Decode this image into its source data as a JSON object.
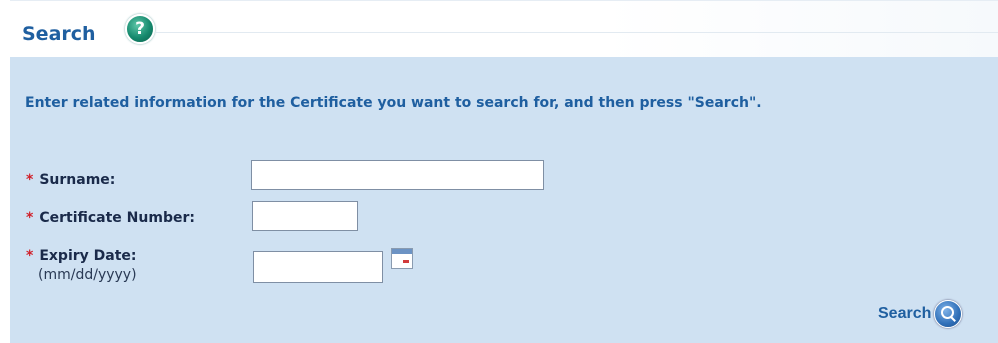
{
  "header": {
    "title": "Search",
    "help_icon": "question-mark-icon",
    "help_glyph": "?"
  },
  "form": {
    "instructions": "Enter related information for the Certificate you want to search for, and then press \"Search\".",
    "required_marker": "*",
    "surname": {
      "label": "Surname:",
      "value": ""
    },
    "certificate_number": {
      "label": "Certificate Number:",
      "value": ""
    },
    "expiry_date": {
      "label": "Expiry Date:",
      "hint": "(mm/dd/yyyy)",
      "value": "",
      "calendar_icon": "calendar-icon"
    },
    "search_button": {
      "label": "Search",
      "icon": "magnifier-icon"
    }
  },
  "colors": {
    "panel_background": "#cfe1f2",
    "title_blue": "#1f5fa0",
    "required_red": "#d0202a",
    "help_green": "#168a6e"
  }
}
